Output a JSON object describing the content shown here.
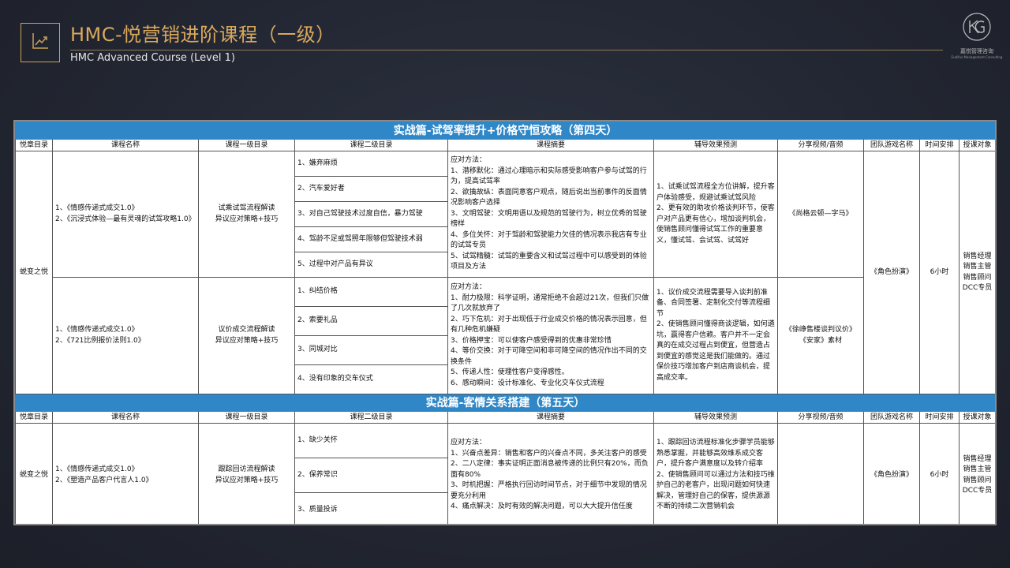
{
  "header": {
    "title": "HMC-悦营销进阶课程（一级）",
    "subtitle": "HMC Advanced Course (Level 1)",
    "logo_icon": "line-chart-icon",
    "brand_cn": "嘉悦管理咨询",
    "brand_en": "Eudifus Management Consulting"
  },
  "columns": [
    "悦章目录",
    "课程名称",
    "课程一级目录",
    "课程二级目录",
    "课程摘要",
    "辅导效果预测",
    "分享视频/音频",
    "团队游戏名称",
    "时间安排",
    "授课对象"
  ],
  "day4": {
    "banner": "实战篇-试驾率提升+价格守恒攻略（第四天）",
    "chapter": "蜕变之悦",
    "game": "《角色扮演》",
    "time": "6小时",
    "audience": "销售经理\n销售主管\n销售顾问\nDCC专员",
    "rows": [
      {
        "courses": "1、《情感传递式成交1.0》\n2、《沉浸式体验—最有灵魂的试驾攻略1.0》",
        "level1": "试乘试驾流程解读\n异议应对策略+技巧",
        "level2": [
          "1、嫌弃麻烦",
          "2、汽车爱好者",
          "3、对自己驾驶技术过度自信，暴力驾驶",
          "4、驾龄不足或驾照年限够但驾驶技术弱",
          "5、过程中对产品有异议"
        ],
        "summary": "应对方法：\n1、潜移默化：通过心理暗示和实际感受影响客户参与试驾的行为，提高试驾率\n2、欲擒故纵：表面同意客户观点，随后说出当前事件的反面情况影响客户选择\n3、文明驾驶：文明用语以及规范的驾驶行为，树立优秀的驾驶榜样\n4、多位关怀：对于驾龄和驾驶能力欠佳的情况表示我店有专业的试驾专员\n5、试驾精髓：试驾的重要含义和试驾过程中可以感受到的体验项目及方法",
        "effect": "1、试乘试驾流程全方位讲解，提升客户体验感受，规避试乘试驾风险\n2、更有效的助攻价格谈判环节，使客户对产品更有信心，增加谈判机会，使销售顾问懂得试驾工作的重要意义，懂试驾、会试驾、试驾好",
        "video": "《尚格云顿—字马》"
      },
      {
        "courses": "1、《情感传递式成交1.0》\n2、《721比例报价法则1.0》",
        "level1": "议价成交流程解读\n异议应对策略+技巧",
        "level2": [
          "1、纠结价格",
          "2、索要礼品",
          "3、同城对比",
          "4、没有印象的交车仪式"
        ],
        "summary": "应对方法：\n1、耐力极限：科学证明，通常拒绝不会超过21次，但我们只做了几次就放弃了\n2、巧下危机：对于出现低于行业成交价格的情况表示回意，但有几种危机嫌疑\n3、价格押宝：可以使客户感受得到的优惠非常珍惜\n4、等价交换：对于可降空间和非可降空间的情况作出不同的交换条件\n5、传递人性：使理性客户变得感性。\n6、感动瞬间：设计标准化、专业化交车仪式流程",
        "effect": "1、议价成交流程需要导入谈判前准备、合同签署、定制化交付等流程细节\n2、使销售顾问懂得商谈逻辑，如何遴坑，赢得客户信赖。客户并不一定会真的在成交过程占到便宜，但营造占到便宜的感觉这是我们能做的。通过保价技巧增加客户到店商谈机会，提高成交率。",
        "video": "《徐峥售楼谈判议价》\n《安家》素材"
      }
    ]
  },
  "day5": {
    "banner": "实战篇-客情关系搭建（第五天）",
    "chapter": "蜕变之悦",
    "game": "《角色扮演》",
    "time": "6小时",
    "audience": "销售经理\n销售主管\n销售顾问\nDCC专员",
    "courses": "1、《情感传递式成交1.0》\n2、《塑造产品客户代言人1.0》",
    "level1": "跟踪回访流程解读\n异议应对策略+技巧",
    "level2": [
      "1、缺少关怀",
      "2、保养常识",
      "3、质量投诉"
    ],
    "summary": "应对方法：\n1、兴奋点差异：销售和客户的兴奋点不同，多关注客户的感受\n2、二八定律：事实证明正面消息被传递的比例只有20%，而负面有80%\n3、时机把握：严格执行回访时间节点，对于细节中发现的情况要充分利用\n4、痛点解决：及时有效的解决问题，可以大大提升信任度",
    "effect": "1、跟踪回访流程标准化步骤学员能够熟悉掌握，并能够高效维系成交客户，提升客户满意度以及转介绍率\n2、使销售顾问可以通过方法和技巧维护自己的老客户，出现问题如何快速解决，管理好自己的保客，提供源源不断的持续二次营销机会",
    "video": ""
  }
}
